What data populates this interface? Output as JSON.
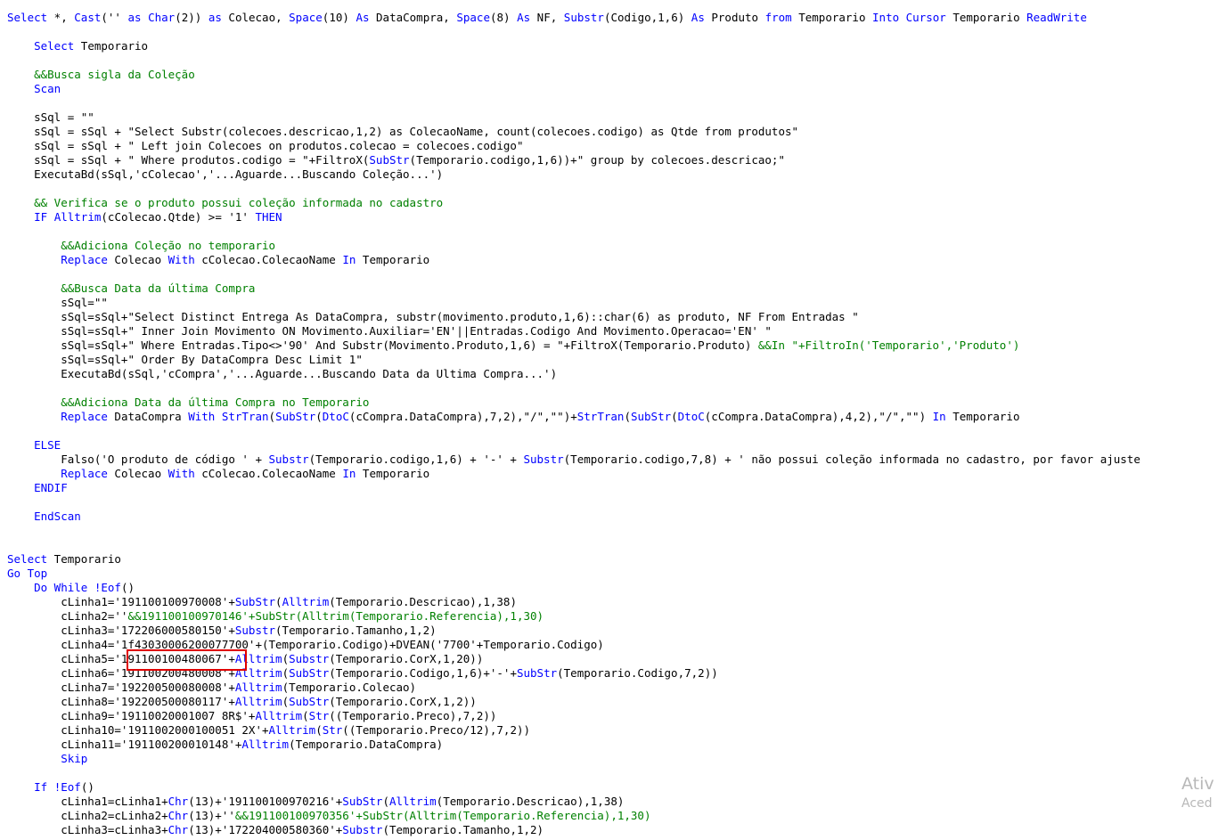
{
  "editor": {
    "lines": [
      [
        [
          "kw",
          "Select"
        ],
        [
          "pl",
          " *, "
        ],
        [
          "kw",
          "Cast"
        ],
        [
          "pl",
          "('' "
        ],
        [
          "kw",
          "as"
        ],
        [
          "pl",
          " "
        ],
        [
          "kw",
          "Char"
        ],
        [
          "pl",
          "(2)) "
        ],
        [
          "kw",
          "as"
        ],
        [
          "pl",
          " Colecao, "
        ],
        [
          "kw",
          "Space"
        ],
        [
          "pl",
          "(10) "
        ],
        [
          "kw",
          "As"
        ],
        [
          "pl",
          " DataCompra, "
        ],
        [
          "kw",
          "Space"
        ],
        [
          "pl",
          "(8) "
        ],
        [
          "kw",
          "As"
        ],
        [
          "pl",
          " NF, "
        ],
        [
          "kw",
          "Substr"
        ],
        [
          "pl",
          "(Codigo,1,6) "
        ],
        [
          "kw",
          "As"
        ],
        [
          "pl",
          " Produto "
        ],
        [
          "kw",
          "from"
        ],
        [
          "pl",
          " Temporario "
        ],
        [
          "kw",
          "Into"
        ],
        [
          "pl",
          " "
        ],
        [
          "kw",
          "Cursor"
        ],
        [
          "pl",
          " Temporario "
        ],
        [
          "kw",
          "ReadWrite"
        ]
      ],
      [],
      [
        [
          "pl",
          "    "
        ],
        [
          "kw",
          "Select"
        ],
        [
          "pl",
          " Temporario"
        ]
      ],
      [],
      [
        [
          "pl",
          "    "
        ],
        [
          "cm",
          "&&Busca sigla da Coleção"
        ]
      ],
      [
        [
          "pl",
          "    "
        ],
        [
          "kw",
          "Scan"
        ]
      ],
      [],
      [
        [
          "pl",
          "    sSql = \"\""
        ]
      ],
      [
        [
          "pl",
          "    sSql = sSql + \"Select Substr(colecoes.descricao,1,2) as ColecaoName, count(colecoes.codigo) as Qtde from produtos\""
        ]
      ],
      [
        [
          "pl",
          "    sSql = sSql + \" Left join Colecoes on produtos.colecao = colecoes.codigo\""
        ]
      ],
      [
        [
          "pl",
          "    sSql = sSql + \" Where produtos.codigo = \"+FiltroX("
        ],
        [
          "kw",
          "SubStr"
        ],
        [
          "pl",
          "(Temporario.codigo,1,6))+\" group by colecoes.descricao;\""
        ]
      ],
      [
        [
          "pl",
          "    ExecutaBd(sSql,'cColecao','...Aguarde...Buscando Coleção...')"
        ]
      ],
      [],
      [
        [
          "pl",
          "    "
        ],
        [
          "cm",
          "&& Verifica se o produto possui coleção informada no cadastro"
        ]
      ],
      [
        [
          "pl",
          "    "
        ],
        [
          "kw",
          "IF"
        ],
        [
          "pl",
          " "
        ],
        [
          "kw",
          "Alltrim"
        ],
        [
          "pl",
          "(cColecao.Qtde) >= '1' "
        ],
        [
          "kw",
          "THEN"
        ]
      ],
      [],
      [
        [
          "pl",
          "        "
        ],
        [
          "cm",
          "&&Adiciona Coleção no temporario"
        ]
      ],
      [
        [
          "pl",
          "        "
        ],
        [
          "kw",
          "Replace"
        ],
        [
          "pl",
          " Colecao "
        ],
        [
          "kw",
          "With"
        ],
        [
          "pl",
          " cColecao.ColecaoName "
        ],
        [
          "kw",
          "In"
        ],
        [
          "pl",
          " Temporario"
        ]
      ],
      [],
      [
        [
          "pl",
          "        "
        ],
        [
          "cm",
          "&&Busca Data da última Compra"
        ]
      ],
      [
        [
          "pl",
          "        sSql=\"\""
        ]
      ],
      [
        [
          "pl",
          "        sSql=sSql+\"Select Distinct Entrega As DataCompra, substr(movimento.produto,1,6)::char(6) as produto, NF From Entradas \""
        ]
      ],
      [
        [
          "pl",
          "        sSql=sSql+\" Inner Join Movimento ON Movimento.Auxiliar='EN'||Entradas.Codigo And Movimento.Operacao='EN' \""
        ]
      ],
      [
        [
          "pl",
          "        sSql=sSql+\" Where Entradas.Tipo<>'90' And Substr(Movimento.Produto,1,6) = \"+FiltroX(Temporario.Produto) "
        ],
        [
          "cm",
          "&&In \"+FiltroIn('Temporario','Produto')"
        ]
      ],
      [
        [
          "pl",
          "        sSql=sSql+\" Order By DataCompra Desc Limit 1\""
        ]
      ],
      [
        [
          "pl",
          "        ExecutaBd(sSql,'cCompra','...Aguarde...Buscando Data da Ultima Compra...')"
        ]
      ],
      [],
      [
        [
          "pl",
          "        "
        ],
        [
          "cm",
          "&&Adiciona Data da última Compra no Temporario"
        ]
      ],
      [
        [
          "pl",
          "        "
        ],
        [
          "kw",
          "Replace"
        ],
        [
          "pl",
          " DataCompra "
        ],
        [
          "kw",
          "With"
        ],
        [
          "pl",
          " "
        ],
        [
          "kw",
          "StrTran"
        ],
        [
          "pl",
          "("
        ],
        [
          "kw",
          "SubStr"
        ],
        [
          "pl",
          "("
        ],
        [
          "kw",
          "DtoC"
        ],
        [
          "pl",
          "(cCompra.DataCompra),7,2),\"/\",\"\")+"
        ],
        [
          "kw",
          "StrTran"
        ],
        [
          "pl",
          "("
        ],
        [
          "kw",
          "SubStr"
        ],
        [
          "pl",
          "("
        ],
        [
          "kw",
          "DtoC"
        ],
        [
          "pl",
          "(cCompra.DataCompra),4,2),\"/\",\"\") "
        ],
        [
          "kw",
          "In"
        ],
        [
          "pl",
          " Temporario"
        ]
      ],
      [],
      [
        [
          "pl",
          "    "
        ],
        [
          "kw",
          "ELSE"
        ]
      ],
      [
        [
          "pl",
          "        Falso('O produto de código ' + "
        ],
        [
          "kw",
          "Substr"
        ],
        [
          "pl",
          "(Temporario.codigo,1,6) + '-' + "
        ],
        [
          "kw",
          "Substr"
        ],
        [
          "pl",
          "(Temporario.codigo,7,8) + ' não possui coleção informada no cadastro, por favor ajuste"
        ]
      ],
      [
        [
          "pl",
          "        "
        ],
        [
          "kw",
          "Replace"
        ],
        [
          "pl",
          " Colecao "
        ],
        [
          "kw",
          "With"
        ],
        [
          "pl",
          " cColecao.ColecaoName "
        ],
        [
          "kw",
          "In"
        ],
        [
          "pl",
          " Temporario"
        ]
      ],
      [
        [
          "pl",
          "    "
        ],
        [
          "kw",
          "ENDIF"
        ]
      ],
      [],
      [
        [
          "pl",
          "    "
        ],
        [
          "kw",
          "EndScan"
        ]
      ],
      [],
      [],
      [
        [
          "kw",
          "Select"
        ],
        [
          "pl",
          " Temporario"
        ]
      ],
      [
        [
          "kw",
          "Go Top"
        ]
      ],
      [
        [
          "pl",
          "    "
        ],
        [
          "kw",
          "Do While"
        ],
        [
          "pl",
          " "
        ],
        [
          "kw",
          "!Eof"
        ],
        [
          "pl",
          "()"
        ]
      ],
      [
        [
          "pl",
          "        cLinha1='191100100970008'+"
        ],
        [
          "kw",
          "SubStr"
        ],
        [
          "pl",
          "("
        ],
        [
          "kw",
          "Alltrim"
        ],
        [
          "pl",
          "(Temporario.Descricao),1,38)"
        ]
      ],
      [
        [
          "pl",
          "        cLinha2=''"
        ],
        [
          "grn",
          "&&191100100970146'+SubStr(Alltrim(Temporario.Referencia),1,30)"
        ]
      ],
      [
        [
          "pl",
          "        cLinha3='172206000580150'+"
        ],
        [
          "kw",
          "Substr"
        ],
        [
          "pl",
          "(Temporario.Tamanho,1,2)"
        ]
      ],
      [
        [
          "pl",
          "        cLinha4='1f43030006200077700'+(Temporario.Codigo)+DVEAN('7700'+Temporario.Codigo)"
        ]
      ],
      [
        [
          "pl",
          "        cLinha5='191100100480067'+"
        ],
        [
          "kw",
          "Alltrim"
        ],
        [
          "pl",
          "("
        ],
        [
          "kw",
          "Substr"
        ],
        [
          "pl",
          "(Temporario.CorX,1,20))"
        ]
      ],
      [
        [
          "pl",
          "        cLinha6='191100200480008'+"
        ],
        [
          "kw",
          "Alltrim"
        ],
        [
          "pl",
          "("
        ],
        [
          "kw",
          "SubStr"
        ],
        [
          "pl",
          "(Temporario.Codigo,1,6)+'-'+"
        ],
        [
          "kw",
          "SubStr"
        ],
        [
          "pl",
          "(Temporario.Codigo,7,2))"
        ]
      ],
      [
        [
          "pl",
          "        cLinha7='192200500080008'+"
        ],
        [
          "kw",
          "Alltrim"
        ],
        [
          "pl",
          "(Temporario.Colecao)"
        ]
      ],
      [
        [
          "pl",
          "        cLinha8='192200500080117'+"
        ],
        [
          "kw",
          "Alltrim"
        ],
        [
          "pl",
          "("
        ],
        [
          "kw",
          "SubStr"
        ],
        [
          "pl",
          "(Temporario.CorX,1,2))"
        ]
      ],
      [
        [
          "pl",
          "        cLinha9='19110020001007 8R$'+"
        ],
        [
          "kw",
          "Alltrim"
        ],
        [
          "pl",
          "("
        ],
        [
          "kw",
          "Str"
        ],
        [
          "pl",
          "((Temporario.Preco),7,2))"
        ]
      ],
      [
        [
          "pl",
          "        cLinha10='1911002000100051 2X'+"
        ],
        [
          "kw",
          "Alltrim"
        ],
        [
          "pl",
          "("
        ],
        [
          "kw",
          "Str"
        ],
        [
          "pl",
          "((Temporario.Preco/12),7,2))"
        ]
      ],
      [
        [
          "pl",
          "        cLinha11='191100200010148'+"
        ],
        [
          "kw",
          "Alltrim"
        ],
        [
          "pl",
          "(Temporario.DataCompra)"
        ]
      ],
      [
        [
          "pl",
          "        "
        ],
        [
          "kw",
          "Skip"
        ]
      ],
      [],
      [
        [
          "pl",
          "    "
        ],
        [
          "kw",
          "If"
        ],
        [
          "pl",
          " "
        ],
        [
          "kw",
          "!Eof"
        ],
        [
          "pl",
          "()"
        ]
      ],
      [
        [
          "pl",
          "        cLinha1=cLinha1+"
        ],
        [
          "kw",
          "Chr"
        ],
        [
          "pl",
          "(13)+'191100100970216'+"
        ],
        [
          "kw",
          "SubStr"
        ],
        [
          "pl",
          "("
        ],
        [
          "kw",
          "Alltrim"
        ],
        [
          "pl",
          "(Temporario.Descricao),1,38)"
        ]
      ],
      [
        [
          "pl",
          "        cLinha2=cLinha2+"
        ],
        [
          "kw",
          "Chr"
        ],
        [
          "pl",
          "(13)+''"
        ],
        [
          "grn",
          "&&191100100970356'+SubStr(Alltrim(Temporario.Referencia),1,30)"
        ]
      ],
      [
        [
          "pl",
          "        cLinha3=cLinha3+"
        ],
        [
          "kw",
          "Chr"
        ],
        [
          "pl",
          "(13)+'172204000580360'+"
        ],
        [
          "kw",
          "Substr"
        ],
        [
          "pl",
          "(Temporario.Tamanho,1,2)"
        ]
      ]
    ]
  },
  "watermark": {
    "line1": "Ativ",
    "line2": "Aced"
  }
}
